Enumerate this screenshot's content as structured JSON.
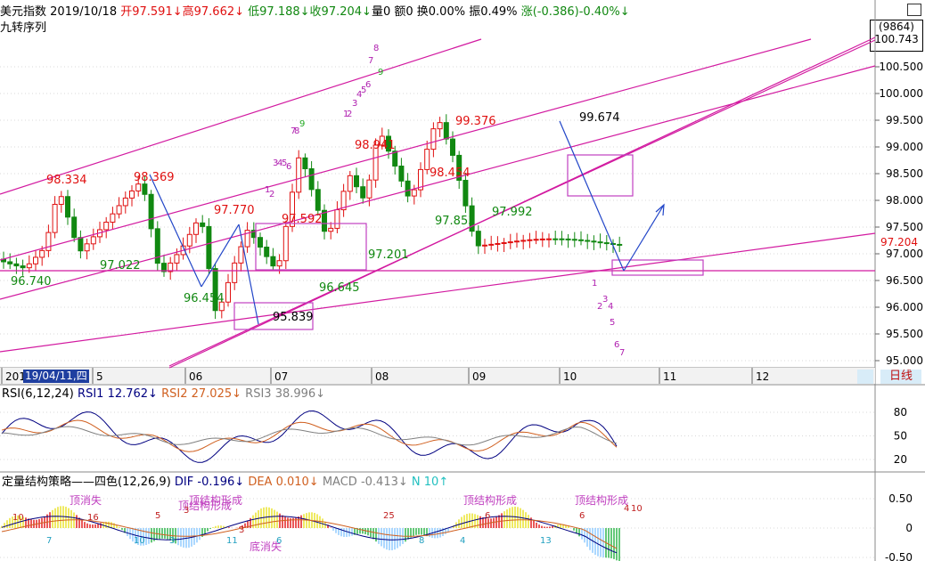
{
  "header": {
    "name": "美元指数",
    "date": "2019/10/18",
    "open": "开97.591↓",
    "high": "高97.662↓",
    "low": "低97.188↓",
    "close": "收97.204↓",
    "volume": "量0",
    "amount": "额0",
    "turnover": "换0.00%",
    "amplitude": "振0.49%",
    "change": "涨(-0.386)-0.40%↓",
    "indicator_name": "九转序列"
  },
  "badge": {
    "code": "(9864)",
    "price": "100.743"
  },
  "current_price_label": "97.204",
  "date_marker": "19/04/11,四",
  "period_button": "日线",
  "colors": {
    "up": "#e01010",
    "down": "#118811",
    "trend": "#d21aa0",
    "box": "#c040c0",
    "arrow": "#2246c8",
    "grid": "#cfcfcf",
    "bg": "#ffffff"
  },
  "chart_data": [
    {
      "type": "candlestick",
      "title": "美元指数",
      "y_ticks": [
        "95.000",
        "95.500",
        "96.000",
        "96.500",
        "97.000",
        "97.500",
        "98.000",
        "98.500",
        "99.000",
        "99.500",
        "100.000",
        "100.500"
      ],
      "ylim": [
        94.95,
        101.0
      ],
      "x_labels": [
        "201",
        "5",
        "06",
        "07",
        "08",
        "09",
        "10",
        "11",
        "12"
      ],
      "price_annotations": [
        {
          "text": "98.334",
          "x": "2019-04-12",
          "y": 98.334,
          "color": "red"
        },
        {
          "text": "98.369",
          "x": "2019-05-23",
          "y": 98.369,
          "color": "red"
        },
        {
          "text": "97.770",
          "x": "2019-06-18",
          "y": 97.77,
          "color": "red"
        },
        {
          "text": "97.592",
          "x": "2019-07-09",
          "y": 97.592,
          "color": "red"
        },
        {
          "text": "98.941",
          "x": "2019-08-01",
          "y": 98.941,
          "color": "red"
        },
        {
          "text": "98.454",
          "x": "2019-08-23",
          "y": 98.454,
          "color": "red"
        },
        {
          "text": "99.376",
          "x": "2019-09-03",
          "y": 99.376,
          "color": "red"
        },
        {
          "text": "99.674",
          "x": "2019-10-01",
          "y": 99.674,
          "color": "black"
        },
        {
          "text": "96.740",
          "x": "2019-03-25",
          "y": 96.74,
          "color": "green"
        },
        {
          "text": "97.022",
          "x": "2019-04-25",
          "y": 97.022,
          "color": "green"
        },
        {
          "text": "96.454",
          "x": "2019-05-31",
          "y": 96.454,
          "color": "green"
        },
        {
          "text": "95.839",
          "x": "2019-06-25",
          "y": 95.839,
          "color": "black"
        },
        {
          "text": "96.645",
          "x": "2019-07-22",
          "y": 96.645,
          "color": "green"
        },
        {
          "text": "97.201",
          "x": "2019-08-13",
          "y": 97.201,
          "color": "green"
        },
        {
          "text": "97.853",
          "x": "2019-08-30",
          "y": 97.853,
          "color": "green"
        },
        {
          "text": "97.992",
          "x": "2019-09-19",
          "y": 97.992,
          "color": "green"
        }
      ],
      "nine_turn_labels": [
        {
          "text": "8"
        },
        {
          "text": "7"
        },
        {
          "text": "9"
        },
        {
          "text": "6"
        },
        {
          "text": "5"
        },
        {
          "text": "4"
        },
        {
          "text": "3"
        },
        {
          "text": "2"
        },
        {
          "text": "1"
        },
        {
          "text": "9"
        },
        {
          "text": "8"
        },
        {
          "text": "7"
        },
        {
          "text": "5"
        },
        {
          "text": "4"
        },
        {
          "text": "3"
        },
        {
          "text": "6"
        },
        {
          "text": "1"
        },
        {
          "text": "2"
        },
        {
          "text": "1"
        },
        {
          "text": "3"
        },
        {
          "text": "2"
        },
        {
          "text": "4"
        },
        {
          "text": "5"
        },
        {
          "text": "6"
        },
        {
          "text": "7"
        }
      ]
    },
    {
      "type": "line",
      "title": "RSI(6,12,24)",
      "series": [
        {
          "name": "RSI1",
          "value": "12.762↓",
          "color": "#000080"
        },
        {
          "name": "RSI2",
          "value": "27.025↓",
          "color": "#d06020"
        },
        {
          "name": "RSI3",
          "value": "38.996↓",
          "color": "#808080"
        }
      ],
      "y_ticks": [
        "80",
        "50",
        "20"
      ],
      "ylim": [
        5,
        95
      ]
    },
    {
      "type": "bar",
      "title": "定量结构策略——四色(12,26,9)",
      "series": [
        {
          "name": "DIF",
          "value": "-0.196↓",
          "color": "#000080"
        },
        {
          "name": "DEA",
          "value": "0.010↓",
          "color": "#d06020"
        },
        {
          "name": "MACD",
          "value": "-0.413↓",
          "color": "#808080"
        },
        {
          "name": "N",
          "value": "10↑",
          "color": "#22c0c0"
        }
      ],
      "y_ticks": [
        "0.50",
        "0",
        "-0.50"
      ],
      "ylim": [
        -0.62,
        0.62
      ],
      "annotations": [
        "顶消失",
        "顶结构形成",
        "顶结构形成",
        "底消失",
        "顶结构形成",
        "顶结构形成"
      ],
      "counts": [
        "10",
        "7",
        "16",
        "10",
        "5",
        "3",
        "3",
        "11",
        "3",
        "6",
        "25",
        "8",
        "4",
        "6",
        "13",
        "6",
        "4",
        "10"
      ]
    }
  ]
}
